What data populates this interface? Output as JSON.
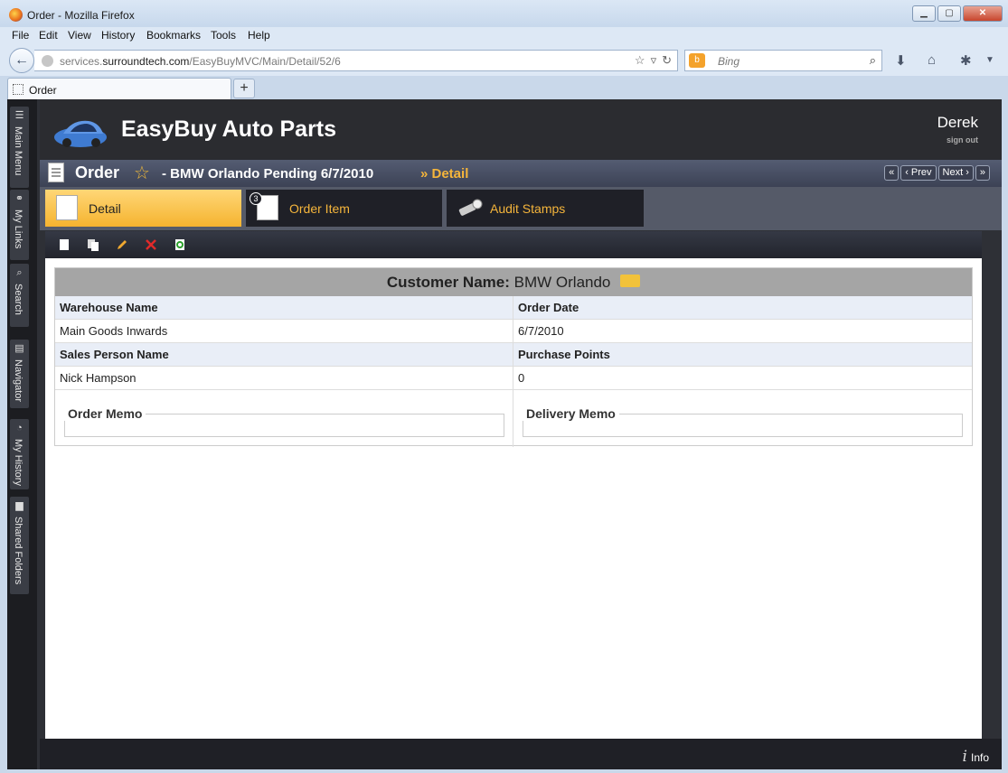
{
  "window": {
    "title": "Order - Mozilla Firefox",
    "min": "▁",
    "max": "▢",
    "close": "✕"
  },
  "menu": {
    "file": "File",
    "edit": "Edit",
    "view": "View",
    "history": "History",
    "bookmarks": "Bookmarks",
    "tools": "Tools",
    "help": "Help"
  },
  "nav": {
    "url_prefix": "services.",
    "url_domain": "surroundtech.com",
    "url_path": "/EasyBuyMVC/Main/Detail/52/6",
    "search_placeholder": "Bing"
  },
  "browser_tab": {
    "label": "Order",
    "new_tab": "+"
  },
  "sidebar": {
    "items": [
      {
        "label": "Main Menu"
      },
      {
        "label": "My Links"
      },
      {
        "label": "Search"
      },
      {
        "label": "Navigator"
      },
      {
        "label": "My History"
      },
      {
        "label": "Shared Folders"
      }
    ]
  },
  "header": {
    "app_title": "EasyBuy Auto Parts",
    "user": "Derek",
    "sign_out": "sign out"
  },
  "order_bar": {
    "title": "Order",
    "subtitle": "- BMW Orlando Pending 6/7/2010",
    "crumb": "» Detail",
    "first": "«",
    "prev": "‹ Prev",
    "next": "Next ›",
    "last": "»"
  },
  "tabs": [
    {
      "label": "Detail",
      "active": true
    },
    {
      "label": "Order Item",
      "badge": "3"
    },
    {
      "label": "Audit Stamps"
    }
  ],
  "detail": {
    "customer_label": "Customer Name:",
    "customer_value": "BMW Orlando",
    "warehouse_label": "Warehouse Name",
    "warehouse_value": "Main Goods Inwards",
    "order_date_label": "Order Date",
    "order_date_value": "6/7/2010",
    "sales_label": "Sales Person Name",
    "sales_value": "Nick Hampson",
    "points_label": "Purchase Points",
    "points_value": "0",
    "order_memo": "Order Memo",
    "delivery_memo": "Delivery Memo"
  },
  "status": {
    "info": "Info"
  }
}
